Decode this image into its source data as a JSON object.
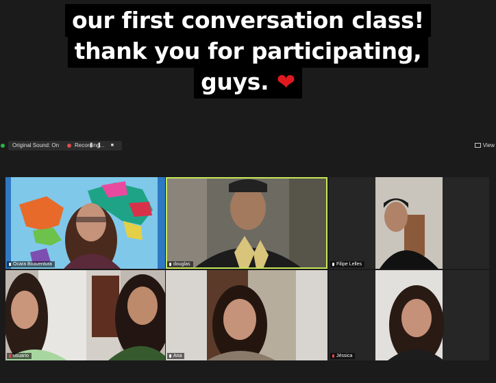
{
  "caption": {
    "line1": "our first conversation class!",
    "line2": "thank you for participating,",
    "line3": "guys.",
    "heart": "❤"
  },
  "toolbar": {
    "original_sound": "Original Sound: On",
    "dropdown_arrow": "▾",
    "recording": "Recording...",
    "recording_controls": "❚❚ ■",
    "view": "View"
  },
  "participants": [
    {
      "name": "Ocara Boaventura",
      "mic": "on"
    },
    {
      "name": "douglas",
      "mic": "on"
    },
    {
      "name": "Filipe Lelles",
      "mic": "on"
    },
    {
      "name": "usuario",
      "mic": "muted"
    },
    {
      "name": "Ana",
      "mic": "on"
    },
    {
      "name": "Jéssica",
      "mic": "muted"
    }
  ],
  "colors": {
    "background": "#1b1b1b",
    "active_speaker": "#c8e85a",
    "recording": "#e24a4a",
    "heart": "#e0191f"
  }
}
